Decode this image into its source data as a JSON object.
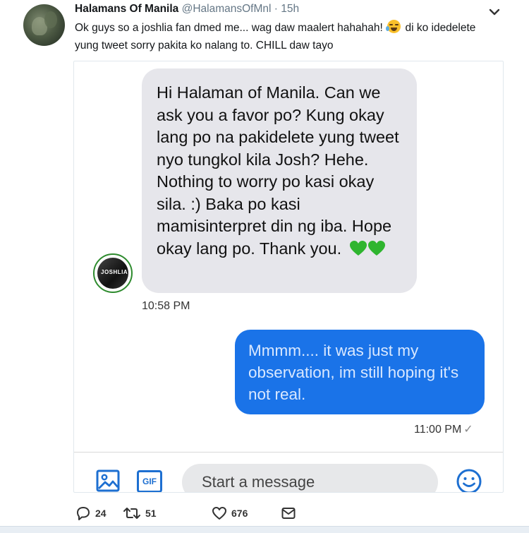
{
  "tweet": {
    "display_name": "Halamans Of Manila",
    "handle": "@HalamansOfMnl",
    "time": "· 15h",
    "text_part1": "Ok guys so a joshlia fan dmed me... wag daw maalert hahahah!",
    "text_emoji": "face-with-tears-of-joy",
    "text_part2": "di ko idedelete yung tweet sorry pakita ko nalang to. CHILL daw tayo"
  },
  "conversation": {
    "incoming": {
      "text": "Hi Halaman of Manila. Can we ask you a favor po? Kung okay lang po na pakidelete yung tweet nyo tungkol kila Josh? Hehe. Nothing to worry po kasi okay sila. :) Baka po kasi mamisinterpret din ng iba. Hope okay lang po. Thank you.",
      "time": "10:58 PM"
    },
    "outgoing": {
      "text": "Mmmm.... it was just my observation, im still hoping it's not real.",
      "time": "11:00 PM",
      "status": "✓"
    },
    "composer": {
      "placeholder": "Start a message",
      "gif_label": "GIF"
    }
  },
  "actions": {
    "replies": "24",
    "retweets": "51",
    "likes": "676"
  },
  "colors": {
    "outgoing_bubble": "#1a73e8",
    "incoming_bubble": "#e6e6eb",
    "icon_blue": "#1d6fd1",
    "heart_green": "#2fb52f"
  }
}
